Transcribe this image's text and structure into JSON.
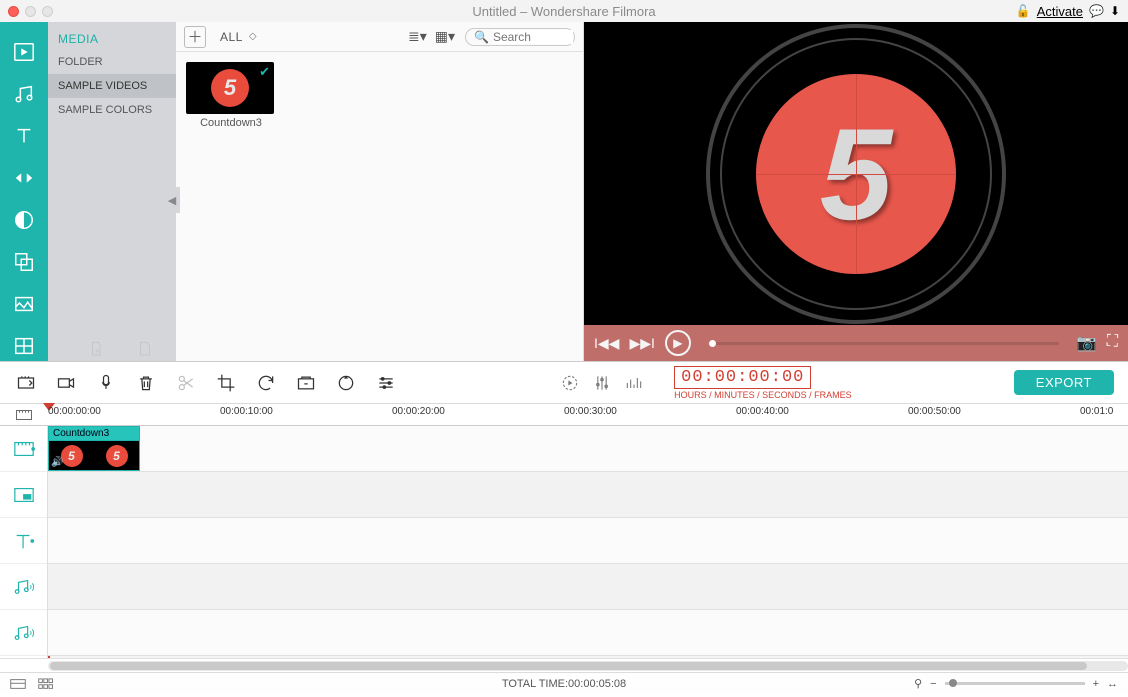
{
  "window": {
    "title": "Untitled – Wondershare Filmora",
    "activate": "Activate"
  },
  "media": {
    "header": "MEDIA",
    "tabs": [
      "FOLDER",
      "SAMPLE VIDEOS",
      "SAMPLE COLORS"
    ],
    "active_tab": "SAMPLE VIDEOS",
    "filter": "ALL",
    "search_placeholder": "Search",
    "items": [
      {
        "name": "Countdown3",
        "selected": true
      }
    ]
  },
  "preview": {
    "countdown_number": "5"
  },
  "timecode": {
    "value": "00:00:00:00",
    "label": "HOURS / MINUTES / SECONDS / FRAMES"
  },
  "export_label": "EXPORT",
  "ruler": {
    "ticks": [
      "00:00:00:00",
      "00:00:10:00",
      "00:00:20:00",
      "00:00:30:00",
      "00:00:40:00",
      "00:00:50:00",
      "00:01:0"
    ]
  },
  "timeline": {
    "clip": {
      "name": "Countdown3"
    }
  },
  "status": {
    "total_time_label": "TOTAL TIME:",
    "total_time_value": "00:00:05:08"
  }
}
